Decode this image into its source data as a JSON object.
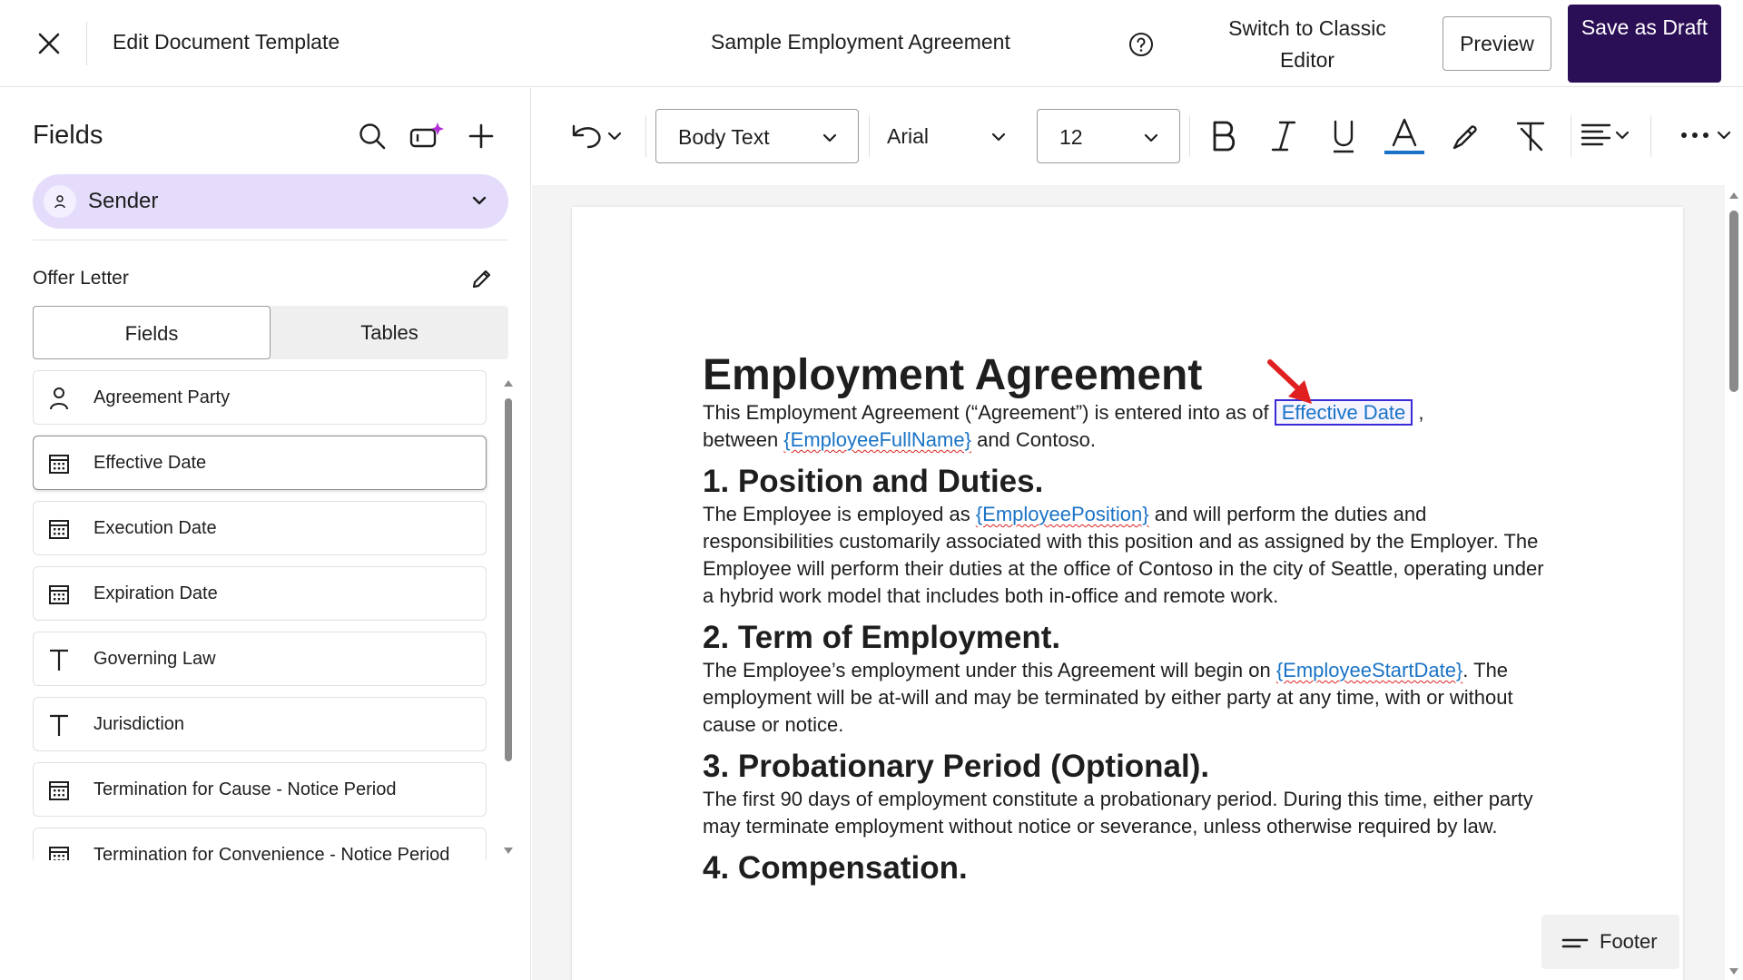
{
  "header": {
    "title": "Edit Document Template",
    "document_name": "Sample Employment Agreement",
    "switch_classic": "Switch to Classic Editor",
    "preview": "Preview",
    "save_draft": "Save as Draft"
  },
  "sidebar": {
    "heading": "Fields",
    "sender": "Sender",
    "section": "Offer Letter",
    "tabs": [
      "Fields",
      "Tables"
    ],
    "fields": [
      {
        "label": "Agreement Party",
        "icon": "person-icon"
      },
      {
        "label": "Effective Date",
        "icon": "calendar-icon"
      },
      {
        "label": "Execution Date",
        "icon": "calendar-icon"
      },
      {
        "label": "Expiration Date",
        "icon": "calendar-icon"
      },
      {
        "label": "Governing Law",
        "icon": "text-icon"
      },
      {
        "label": "Jurisdiction",
        "icon": "text-icon"
      },
      {
        "label": "Termination for Cause - Notice Period",
        "icon": "calendar-icon"
      },
      {
        "label": "Termination for Convenience - Notice Period",
        "icon": "calendar-icon"
      }
    ]
  },
  "toolbar": {
    "style": "Body Text",
    "font": "Arial",
    "size": "12"
  },
  "document": {
    "title": "Employment Agreement",
    "intro_a": "This Employment Agreement (“Agreement”) is entered into as of ",
    "intro_field": "Effective Date",
    "intro_b": " ,",
    "intro_c": "between ",
    "intro_tag": "{EmployeeFullName}",
    "intro_d": " and Contoso.",
    "s1_title": "1. Position and Duties.",
    "s1_a": "The Employee is employed as ",
    "s1_tag": "{EmployeePosition}",
    "s1_b": " and will perform the duties and responsibilities customarily associated with this position and as assigned by the Employer. The Employee will perform their duties at the office of Contoso in the city of Seattle, operating under a hybrid work model that includes both in-office and remote work.",
    "s2_title": "2. Term of Employment.",
    "s2_a": "The Employee’s employment under this Agreement will begin on ",
    "s2_tag": "{EmployeeStartDate}",
    "s2_b": ". The employment will be at-will and may be terminated by either party at any time, with or without cause or notice.",
    "s3_title": "3. Probationary Period (Optional).",
    "s3_text": "The first 90 days of employment constitute a probationary period. During this time, either party may terminate employment without notice or severance, unless otherwise required by law.",
    "s4_title": "4. Compensation."
  },
  "footer_chip": "Footer",
  "colors": {
    "primary": "#2b0f56",
    "sender_bg": "#e4dcfa",
    "tag": "#1a73c6",
    "field_border": "#3b2bd6",
    "arrow": "#e02020"
  }
}
